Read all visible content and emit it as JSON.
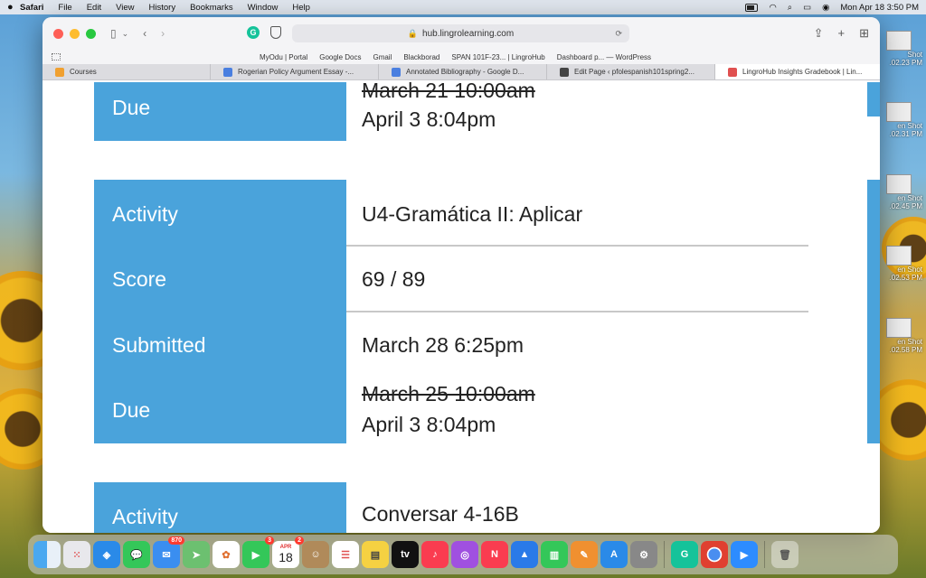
{
  "menubar": {
    "app": "Safari",
    "items": [
      "File",
      "Edit",
      "View",
      "History",
      "Bookmarks",
      "Window",
      "Help"
    ],
    "clock": "Mon Apr 18  3:50 PM"
  },
  "desktop": {
    "screenshots": [
      {
        "line1": "Shot",
        "line2": ".02.23 PM"
      },
      {
        "line1": "en Shot",
        "line2": ".02.31 PM"
      },
      {
        "line1": "en Shot",
        "line2": ".02.45 PM"
      },
      {
        "line1": "en Shot",
        "line2": ".02.53 PM"
      },
      {
        "line1": "en Shot",
        "line2": ".02.58 PM"
      }
    ]
  },
  "browser": {
    "url": "hub.lingrolearning.com",
    "bookmarks": [
      "MyOdu | Portal",
      "Google Docs",
      "Gmail",
      "Blackborad",
      "SPAN 101F-23... | LingroHub",
      "Dashboard p... — WordPress"
    ],
    "tabs": [
      {
        "label": "Courses",
        "color": "#f0a030"
      },
      {
        "label": "Rogerian Policy Argument Essay -...",
        "color": "#4a7fe0"
      },
      {
        "label": "Annotated Bibliography - Google D...",
        "color": "#4a7fe0"
      },
      {
        "label": "Edit Page ‹ pfolespanish101spring2...",
        "color": "#444"
      },
      {
        "label": "LingroHub Insights Gradebook | Lin...",
        "color": "#e05050"
      }
    ]
  },
  "gradebook": {
    "card0": {
      "due_label": "Due",
      "due_original": "March 21 10:00am",
      "due_extended": "April 3   8:04pm"
    },
    "card1": {
      "activity_label": "Activity",
      "activity": "U4-Gramática II: Aplicar",
      "score_label": "Score",
      "score": "69 / 89",
      "submitted_label": "Submitted",
      "submitted": "March 28   6:25pm",
      "due_label": "Due",
      "due_original": "March 25 10:00am",
      "due_extended": "April 3   8:04pm"
    },
    "card2": {
      "activity_label": "Activity",
      "activity": "Conversar 4-16B"
    }
  },
  "dock": {
    "calendar_month": "APR",
    "calendar_day": "18",
    "mail_badge": "870",
    "facetime_badge": "3",
    "calendar_badge": "2",
    "tv_label": "tv"
  }
}
